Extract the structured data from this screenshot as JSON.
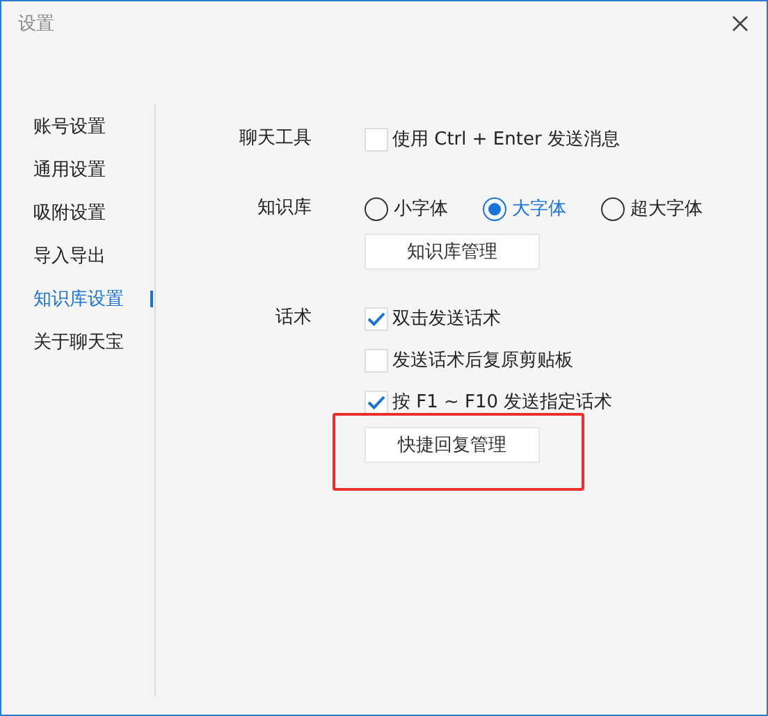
{
  "window": {
    "title": "设置"
  },
  "sidebar": {
    "items": [
      {
        "label": "账号设置",
        "selected": false
      },
      {
        "label": "通用设置",
        "selected": false
      },
      {
        "label": "吸附设置",
        "selected": false
      },
      {
        "label": "导入导出",
        "selected": false
      },
      {
        "label": "知识库设置",
        "selected": true
      },
      {
        "label": "关于聊天宝",
        "selected": false
      }
    ]
  },
  "sections": [
    {
      "label": "聊天工具",
      "controls": [
        {
          "kind": "checkbox",
          "label": "使用 Ctrl + Enter 发送消息",
          "checked": false
        }
      ]
    },
    {
      "label": "知识库",
      "controls": [
        {
          "kind": "radio_group",
          "options": [
            {
              "label": "小字体",
              "selected": false
            },
            {
              "label": "大字体",
              "selected": true
            },
            {
              "label": "超大字体",
              "selected": false
            }
          ]
        },
        {
          "kind": "button",
          "label": "知识库管理",
          "highlighted": false
        }
      ]
    },
    {
      "label": "话术",
      "controls": [
        {
          "kind": "checkbox",
          "label": "双击发送话术",
          "checked": true
        },
        {
          "kind": "checkbox",
          "label": "发送话术后复原剪贴板",
          "checked": false
        },
        {
          "kind": "checkbox",
          "label": "按 F1 ~ F10 发送指定话术",
          "checked": true
        },
        {
          "kind": "button",
          "label": "快捷回复管理",
          "highlighted": true
        }
      ]
    }
  ]
}
